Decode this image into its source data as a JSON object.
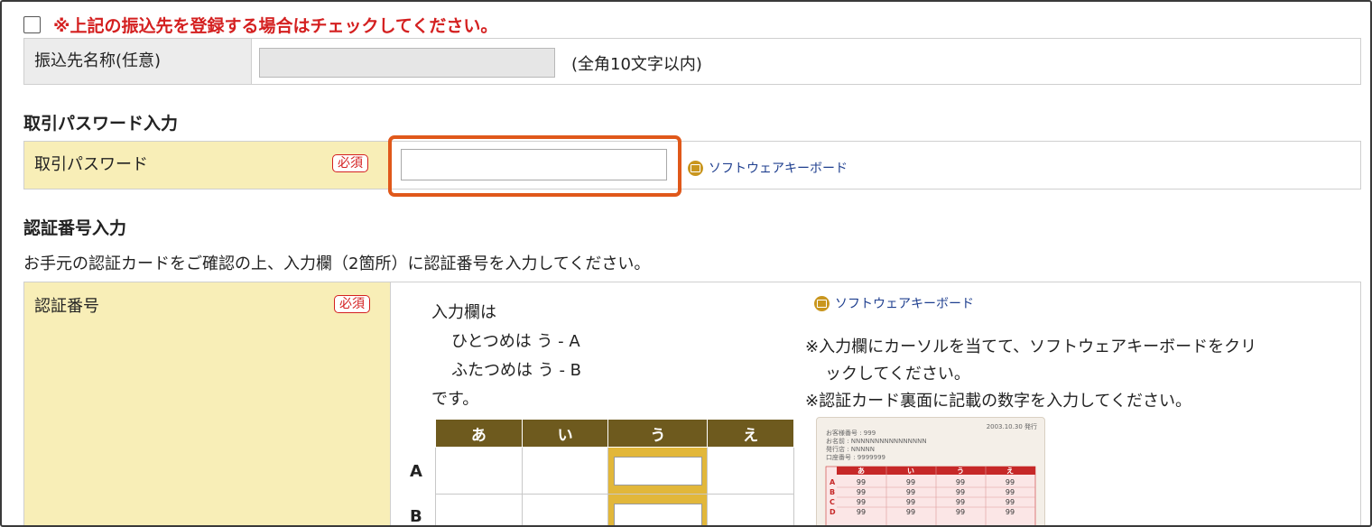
{
  "register": {
    "checkbox_checked": false,
    "note": "※上記の振込先を登録する場合はチェックしてください。"
  },
  "payee_name": {
    "label": "振込先名称(任意)",
    "value": "",
    "hint": "(全角10文字以内)"
  },
  "password_section": {
    "title": "取引パスワード入力",
    "label": "取引パスワード",
    "required": "必須",
    "value": "",
    "keyboard_link": "ソフトウェアキーボード"
  },
  "auth_section": {
    "title": "認証番号入力",
    "description": "お手元の認証カードをご確認の上、入力欄（2箇所）に認証番号を入力してください。",
    "label": "認証番号",
    "required": "必須",
    "instructions": [
      "入力欄は",
      "ひとつめは う - A",
      "ふたつめは う - B",
      "です。"
    ],
    "grid_headers": [
      "あ",
      "い",
      "う",
      "え"
    ],
    "row_labels": [
      "A",
      "B"
    ],
    "input_one": "",
    "input_two": "",
    "keyboard_link": "ソフトウェアキーボード",
    "notes": [
      "※入力欄にカーソルを当てて、ソフトウェアキーボードをクリ",
      "ックしてください。",
      "※認証カード裏面に記載の数字を入力してください。"
    ]
  },
  "card_image": {
    "date": "2003.10.30 発行",
    "info_lines": [
      "お客様番号 : 999",
      "お名前 : NNNNNNNNNNNNNNNN",
      "発行店 : NNNNN",
      "口座番号 : 9999999"
    ],
    "headers": [
      "あ",
      "い",
      "う",
      "え"
    ],
    "row_labels": [
      "A",
      "B",
      "C",
      "D"
    ],
    "value": "99"
  },
  "colors": {
    "accent_highlight": "#e0581a",
    "required_red": "#d42020",
    "label_yellow": "#f8eeb7",
    "grid_header_brown": "#6e5a1e"
  }
}
